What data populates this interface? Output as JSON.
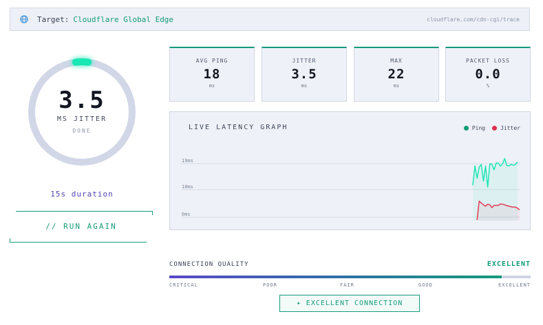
{
  "target": {
    "label": "Target:",
    "name": "Cloudflare Global Edge",
    "url": "cloudflare.com/cdn-cgi/trace"
  },
  "gauge": {
    "value": "3.5",
    "unit": "MS JITTER",
    "status": "DONE",
    "duration": "15s duration",
    "progress": 0.04
  },
  "run_button": {
    "label": "// RUN AGAIN"
  },
  "stats": [
    {
      "label": "AVG PING",
      "value": "18",
      "unit": "ms"
    },
    {
      "label": "JITTER",
      "value": "3.5",
      "unit": "ms"
    },
    {
      "label": "MAX",
      "value": "22",
      "unit": "ms"
    },
    {
      "label": "PACKET LOSS",
      "value": "0.0",
      "unit": "%"
    }
  ],
  "graph": {
    "title": "LIVE LATENCY GRAPH",
    "y_labels": [
      "19ms",
      "10ms",
      "0ms"
    ],
    "legend": [
      {
        "label": "Ping",
        "color": "#0f9b76"
      },
      {
        "label": "Jitter",
        "color": "#e0304d"
      }
    ]
  },
  "chart_data": {
    "type": "line",
    "title": "LIVE LATENCY GRAPH",
    "xlabel": "",
    "ylabel": "",
    "y_tick_labels": [
      "19ms",
      "10ms",
      "0ms"
    ],
    "ylim": [
      0,
      20
    ],
    "grid": true,
    "legend_position": "top-right",
    "series": [
      {
        "name": "Ping",
        "color": "#19e7b4",
        "x": [
          0,
          1,
          2,
          3,
          4,
          5,
          6,
          7,
          8,
          9,
          10,
          11,
          12,
          13,
          14,
          15,
          16,
          17,
          18,
          19,
          20,
          21
        ],
        "values": [
          12.5,
          19.4,
          15.0,
          19.0,
          19.9,
          14.0,
          19.4,
          11.9,
          20.1,
          20.0,
          18.0,
          20.4,
          20.4,
          19.3,
          20.2,
          22.0,
          19.5,
          19.4,
          20.0,
          19.6,
          19.9,
          20.8
        ]
      },
      {
        "name": "Jitter",
        "color": "#e23a55",
        "x": [
          2,
          3,
          4,
          5,
          6,
          7,
          8,
          9,
          10,
          11,
          12,
          13,
          14,
          15,
          16,
          17,
          18,
          19,
          20,
          21,
          22
        ],
        "values": [
          0.2,
          6.9,
          6.2,
          5.6,
          5.1,
          5.8,
          5.6,
          4.6,
          5.4,
          5.4,
          5.4,
          5.9,
          5.8,
          5.6,
          5.3,
          5.1,
          4.9,
          4.8,
          4.8,
          4.4,
          3.8
        ]
      }
    ]
  },
  "quality": {
    "label": "CONNECTION QUALITY",
    "value": "EXCELLENT",
    "fill_fraction": 0.92,
    "ticks": [
      "CRITICAL",
      "POOR",
      "FAIR",
      "GOOD",
      "EXCELLENT"
    ],
    "badge": "✦ EXCELLENT CONNECTION"
  }
}
